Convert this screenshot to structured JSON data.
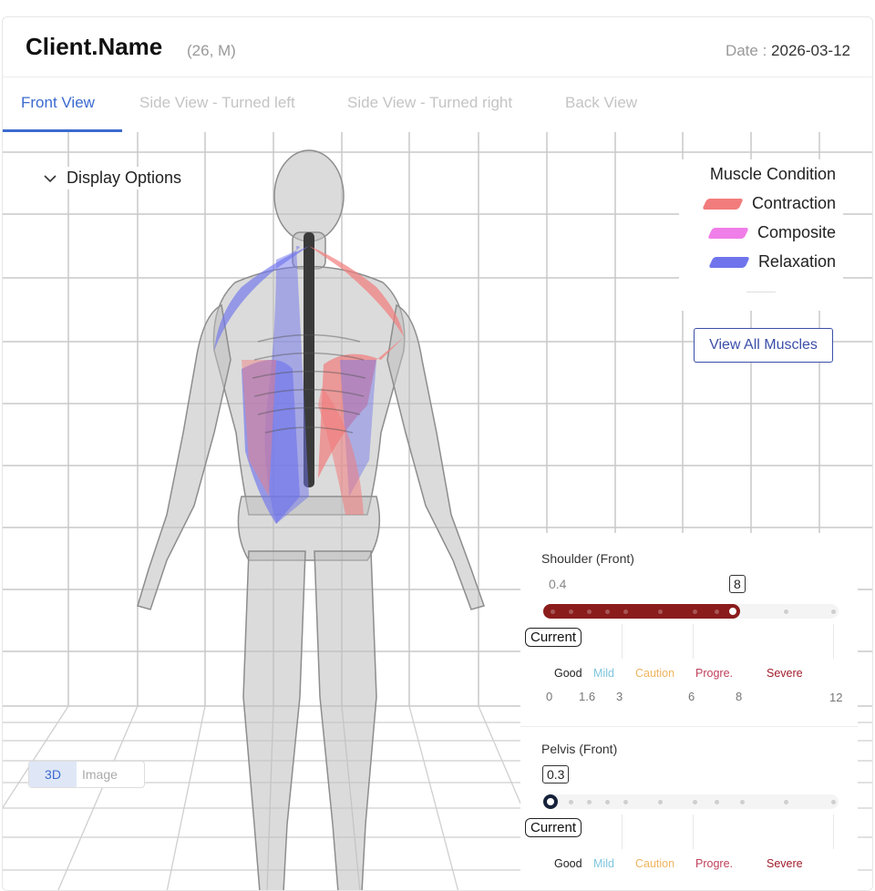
{
  "header": {
    "client_name": "Client.Name",
    "client_meta": "(26, M)",
    "date_label": "Date :",
    "date_value": "2026-03-12"
  },
  "tabs": [
    {
      "label": "Front View",
      "active": true
    },
    {
      "label": "Side View - Turned left",
      "active": false
    },
    {
      "label": "Side View - Turned right",
      "active": false
    },
    {
      "label": "Back View",
      "active": false
    }
  ],
  "display_options": {
    "label": "Display Options",
    "icon": "chevron-down-icon"
  },
  "legend": {
    "title": "Muscle Condition",
    "items": [
      {
        "label": "Contraction",
        "color": "#f27c7c"
      },
      {
        "label": "Composite",
        "color": "#f07ee8"
      },
      {
        "label": "Relaxation",
        "color": "#6f74ec"
      }
    ],
    "button_label": "View All Muscles"
  },
  "metrics": [
    {
      "title": "Shoulder (Front)",
      "baseline": "0.4",
      "current_value": "8",
      "current_fraction": 0.667,
      "current_label": "Current",
      "fill_color": "#8b1c1c"
    },
    {
      "title": "Pelvis (Front)",
      "baseline": "",
      "current_value": "0.3",
      "current_fraction": 0.025,
      "current_label": "Current",
      "fill_color": "#16223a"
    }
  ],
  "scale": {
    "bands": [
      {
        "label": "Good",
        "color": "#222222"
      },
      {
        "label": "Mild",
        "color": "#7fc6de"
      },
      {
        "label": "Caution",
        "color": "#f0b45e"
      },
      {
        "label": "Progre.",
        "color": "#c0405a"
      },
      {
        "label": "Severe",
        "color": "#a01c2c"
      }
    ],
    "ticks": [
      "0",
      "1.6",
      "3",
      "6",
      "8",
      "12"
    ]
  },
  "view_toggle": {
    "option_3d": "3D",
    "option_image": "Image"
  }
}
